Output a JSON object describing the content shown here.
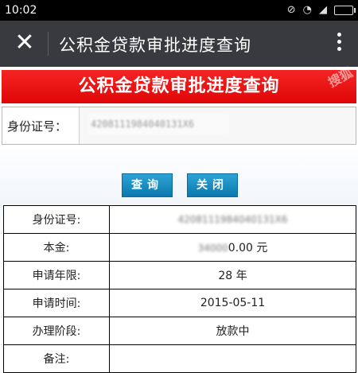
{
  "status_bar": {
    "time": "10:02"
  },
  "app_bar": {
    "title": "公积金贷款审批进度查询"
  },
  "page": {
    "banner_title": "公积金贷款审批进度查询",
    "watermark": "搜狐",
    "id_label": "身份证号：",
    "id_value": "4208111984040131X6",
    "query_button": "查询",
    "close_button": "关闭"
  },
  "result": {
    "rows": [
      {
        "label": "身份证号:",
        "value_blur": "4208111984040131X6",
        "value": ""
      },
      {
        "label": "本金:",
        "value_blur": "34000",
        "value": "0.00 元"
      },
      {
        "label": "申请年限:",
        "value_blur": "",
        "value": "28 年"
      },
      {
        "label": "申请时间:",
        "value_blur": "",
        "value": "2015-05-11"
      },
      {
        "label": "办理阶段:",
        "value_blur": "",
        "value": "放款中"
      },
      {
        "label": "备注:",
        "value_blur": "",
        "value": ""
      }
    ]
  },
  "icons": [
    "close-icon",
    "more-vert-icon",
    "wifi-icon",
    "signal-icon",
    "battery-icon",
    "alarm-off-icon"
  ]
}
